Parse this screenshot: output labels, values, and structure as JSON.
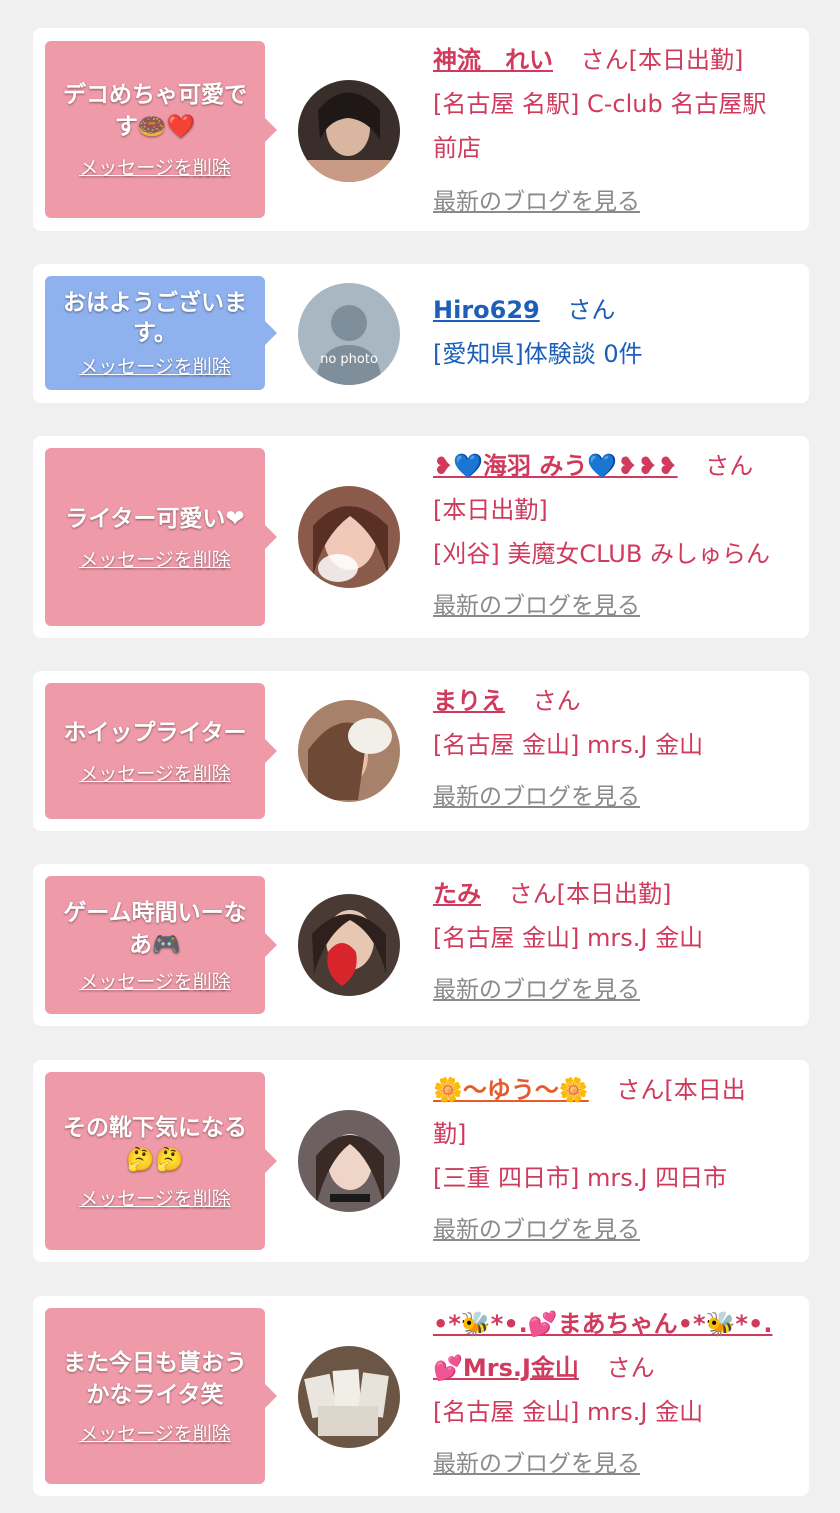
{
  "delete_label": "メッセージを削除",
  "blog_label": "最新のブログを見る",
  "san": "さん",
  "cards": [
    {
      "message_lines": [
        "デコめちゃ可愛で",
        "す🍩❤️"
      ],
      "name": "神流　れい",
      "san_suffix": "さん[本日出勤]",
      "shop": "[名古屋 名駅] C-club 名古屋駅",
      "shop2": "前店"
    },
    {
      "message_lines": [
        "おはようございま",
        "す。"
      ],
      "name": "Hiro629",
      "san_suffix": "さん",
      "review": "[愛知県]体験談 0件",
      "avatar_text": "no photo"
    },
    {
      "message_lines": [
        "ライター可愛い❤"
      ],
      "name": "❥💙海羽 みう💙❥❥❥",
      "san_suffix": "さん",
      "status": "[本日出勤]",
      "shop": "[刈谷] 美魔女CLUB みしゅらん"
    },
    {
      "message_lines": [
        "ホイップライター"
      ],
      "name": "まりえ",
      "san_suffix": "さん",
      "shop": "[名古屋 金山] mrs.J 金山"
    },
    {
      "message_lines": [
        "ゲーム時間いーな",
        "あ🎮"
      ],
      "name": "たみ",
      "san_suffix": "さん[本日出勤]",
      "shop": "[名古屋 金山] mrs.J 金山"
    },
    {
      "message_lines": [
        "その靴下気になる",
        "🤔🤔"
      ],
      "name": "🌼〜ゆう〜🌼",
      "san_suffix": "さん[本日出",
      "san_suffix2": "勤]",
      "shop": "[三重 四日市] mrs.J 四日市"
    },
    {
      "message_lines": [
        "また今日も貰おう",
        "かなライタ笑"
      ],
      "name": "•*🐝*•.💕まあちゃん•*🐝*•.",
      "name2": "💕Mrs.J金山",
      "san_suffix": "さん",
      "shop": "[名古屋 金山] mrs.J 金山"
    }
  ],
  "colors": {
    "pink_bubble": "#ef9aa8",
    "blue_bubble": "#8fb1ee",
    "name_pink": "#cf3a5d",
    "name_blue": "#1d5fb8",
    "blog_gray": "#8a8a8a"
  }
}
